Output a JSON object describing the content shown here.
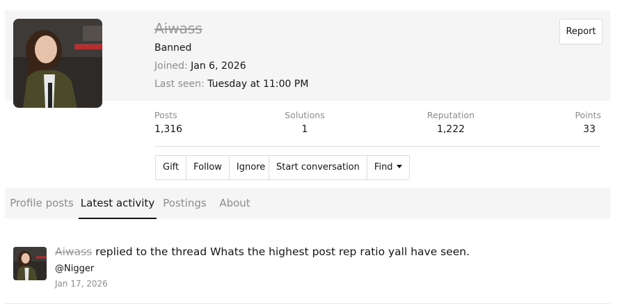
{
  "profile": {
    "username": "Aiwass",
    "user_title": "Banned",
    "joined_label": "Joined:",
    "joined_value": "Jan 6, 2026",
    "last_seen_label": "Last seen:",
    "last_seen_value": "Tuesday at 11:00 PM",
    "report_label": "Report"
  },
  "stats": [
    {
      "label": "Posts",
      "value": "1,316"
    },
    {
      "label": "Solutions",
      "value": "1"
    },
    {
      "label": "Reputation",
      "value": "1,222"
    },
    {
      "label": "Points",
      "value": "33"
    }
  ],
  "actions": {
    "gift": "Gift",
    "follow": "Follow",
    "ignore": "Ignore",
    "start_conversation": "Start conversation",
    "find": "Find"
  },
  "tabs": [
    {
      "label": "Profile posts",
      "active": false
    },
    {
      "label": "Latest activity",
      "active": true
    },
    {
      "label": "Postings",
      "active": false
    },
    {
      "label": "About",
      "active": false
    }
  ],
  "activity": [
    {
      "user": "Aiwass",
      "action_text": " replied to the thread Whats the highest post rep ratio yall have seen.",
      "snippet": "@Nigger",
      "date": "Jan 17, 2026"
    }
  ],
  "colors": {
    "panel_bg": "#f5f5f5",
    "text": "#141414",
    "muted": "#8c8c8c",
    "border": "#dcdcdc"
  },
  "icons": {
    "find_dropdown": "caret-down-icon"
  }
}
